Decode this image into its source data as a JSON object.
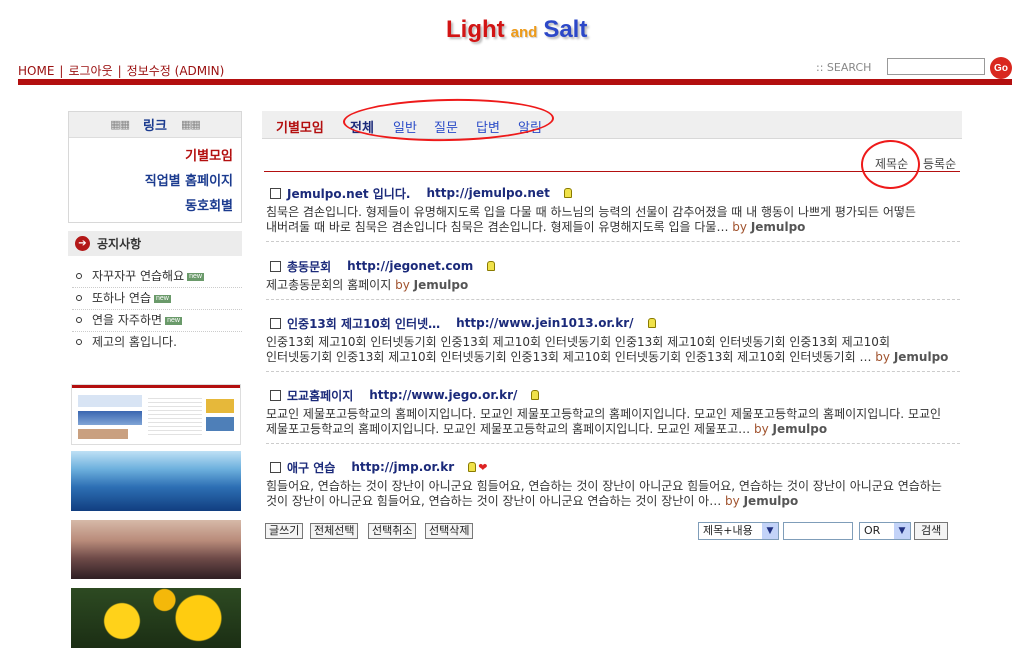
{
  "logo": {
    "word1": "Light",
    "word2": "and",
    "word3": "Salt"
  },
  "topnav": {
    "home": "HOME",
    "logout": "로그아웃",
    "edit": "정보수정 (ADMIN)",
    "sep": "|"
  },
  "search": {
    "label": ":: SEARCH",
    "value": "",
    "go": "Go"
  },
  "links": {
    "title": "링크",
    "items": [
      "기별모임",
      "직업별 홈페이지",
      "동호회별"
    ]
  },
  "notice": {
    "title": "공지사항",
    "new_badge": "new",
    "items": [
      {
        "text": "자꾸자꾸 연습해요",
        "new": true
      },
      {
        "text": "또하나 연습",
        "new": true
      },
      {
        "text": "연을 자주하면",
        "new": true
      },
      {
        "text": "제고의 홈입니다.",
        "new": false
      }
    ]
  },
  "categories": {
    "main": "기별모임",
    "tabs": [
      "전체",
      "일반",
      "질문",
      "답변",
      "알림"
    ]
  },
  "sort": {
    "by_title": "제목순",
    "by_date": "등록순"
  },
  "posts": [
    {
      "title": "Jemulpo.net 입니다.",
      "url": "http://jemulpo.net",
      "body": "침묵은 겸손입니다. 형제들이 유명해지도록 입을 다물 때 하느님의 능력의 선물이 감추어졌을 때 내 행동이 나쁘게 평가되든 어떻든 내버려둘 때 바로 침묵은 겸손입니다 침묵은 겸손입니다. 형제들이 유명해지도록 입을 다물…",
      "by": "by",
      "author": "Jemulpo",
      "heart": false
    },
    {
      "title": "총동문회",
      "url": "http://jegonet.com",
      "body": "제고총동문회의 홈페이지",
      "by": "by",
      "author": "Jemulpo",
      "heart": false
    },
    {
      "title": "인중13회 제고10회 인터넷…",
      "url": "http://www.jein1013.or.kr/",
      "body": "인중13회 제고10회 인터넷동기회 인중13회 제고10회 인터넷동기회 인중13회 제고10회 인터넷동기회 인중13회 제고10회 인터넷동기회 인중13회 제고10회 인터넷동기회 인중13회 제고10회 인터넷동기회 인중13회 제고10회 인터넷동기회 …",
      "by": "by",
      "author": "Jemulpo",
      "heart": false
    },
    {
      "title": "모교홈페이지",
      "url": "http://www.jego.or.kr/",
      "body": "모교인 제물포고등학교의 홈페이지입니다. 모교인 제물포고등학교의 홈페이지입니다. 모교인 제물포고등학교의 홈페이지입니다. 모교인 제물포고등학교의 홈페이지입니다. 모교인 제물포고등학교의 홈페이지입니다. 모교인 제물포고…",
      "by": "by",
      "author": "Jemulpo",
      "heart": false
    },
    {
      "title": "애구 연습",
      "url": "http://jmp.or.kr",
      "body": "힘들어요, 연습하는 것이 장난이 아니군요 힘들어요, 연습하는 것이 장난이 아니군요 힘들어요, 연습하는 것이 장난이 아니군요 연습하는 것이 장난이 아니군요 힘들어요, 연습하는 것이 장난이 아니군요 연습하는 것이 장난이 아…",
      "by": "by",
      "author": "Jemulpo",
      "heart": true
    }
  ],
  "buttons": {
    "write": "글쓰기",
    "select_all": "전체선택",
    "deselect": "선택취소",
    "delete": "선택삭제",
    "search": "검색"
  },
  "filters": {
    "field": "제목+내용",
    "op": "OR",
    "keyword": ""
  }
}
